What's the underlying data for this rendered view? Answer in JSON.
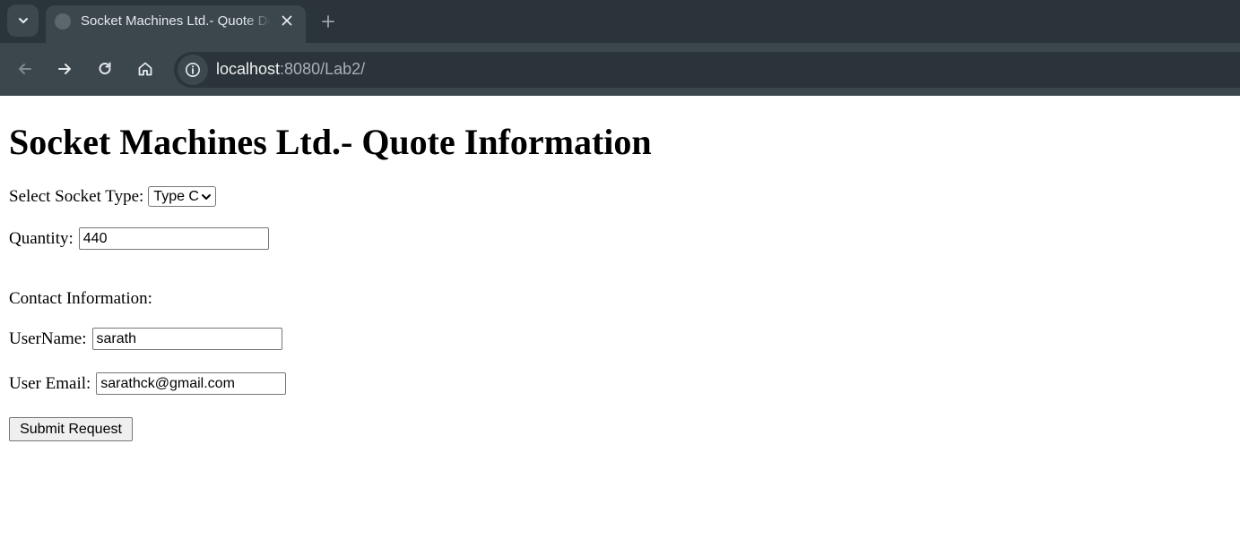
{
  "browser": {
    "tab_title": "Socket Machines Ltd.- Quote Details",
    "url_host": "localhost",
    "url_rest": ":8080/Lab2/",
    "icons": {
      "tab_search": "chevron-down-icon",
      "favicon": "globe-icon",
      "tab_close": "close-icon",
      "new_tab": "plus-icon",
      "back": "arrow-left-icon",
      "forward": "arrow-right-icon",
      "reload": "reload-icon",
      "home": "home-icon",
      "site_info": "info-icon"
    },
    "colors": {
      "tabstrip": "#2b343a",
      "toolbar": "#3b464d"
    }
  },
  "page": {
    "heading": "Socket Machines Ltd.- Quote Information",
    "socket_label": "Select Socket Type:",
    "socket_value": "Type C",
    "quantity_label": "Quantity:",
    "quantity_value": "440",
    "contact_heading": "Contact Information:",
    "username_label": "UserName:",
    "username_value": "sarath",
    "email_label": "User Email:",
    "email_value": "sarathck@gmail.com",
    "submit_label": "Submit Request"
  }
}
